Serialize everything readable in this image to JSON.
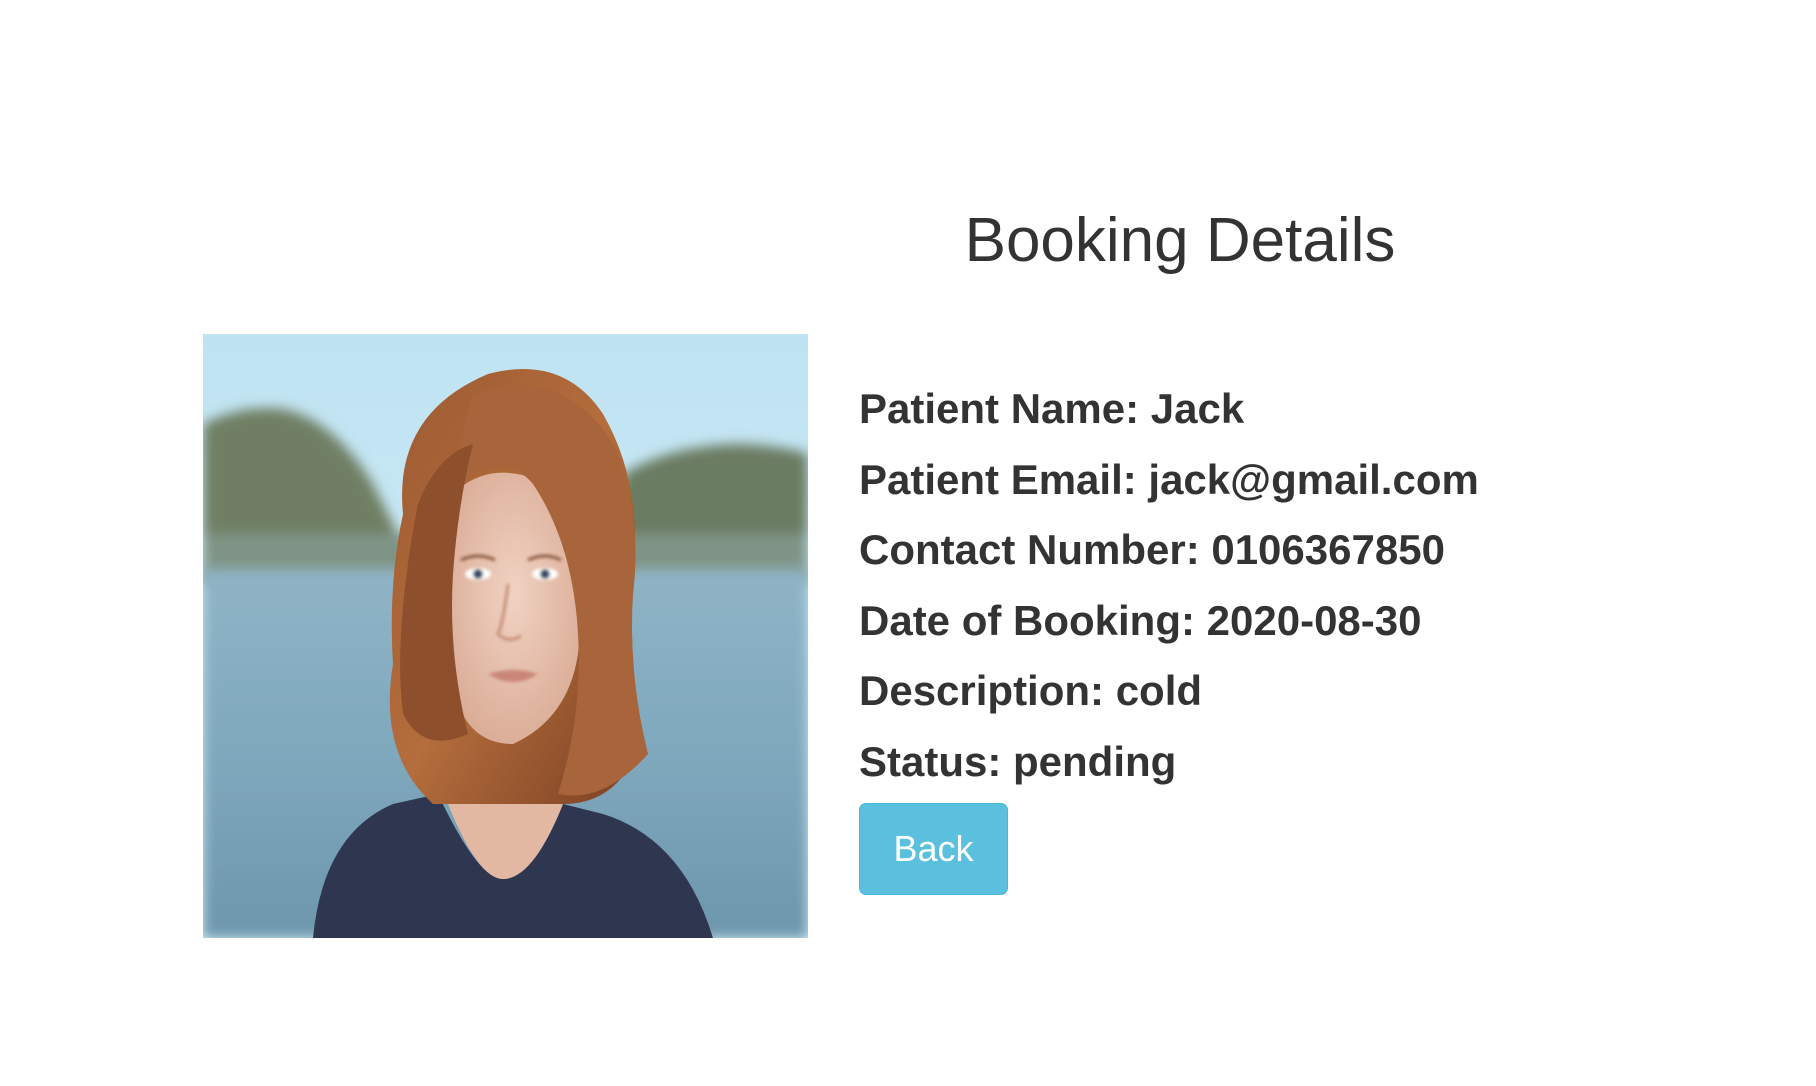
{
  "page": {
    "title": "Booking Details"
  },
  "photo": {
    "icon": "patient-photo"
  },
  "details": {
    "patient_name": "Patient Name: Jack",
    "patient_email": "Patient Email: jack@gmail.com",
    "contact_number": "Contact Number: 0106367850",
    "date_of_booking": "Date of Booking: 2020-08-30",
    "description": "Description: cold",
    "status": "Status: pending"
  },
  "actions": {
    "back_label": "Back"
  },
  "colors": {
    "button_bg": "#5bc0de",
    "button_border": "#46b8da",
    "text": "#333333"
  }
}
